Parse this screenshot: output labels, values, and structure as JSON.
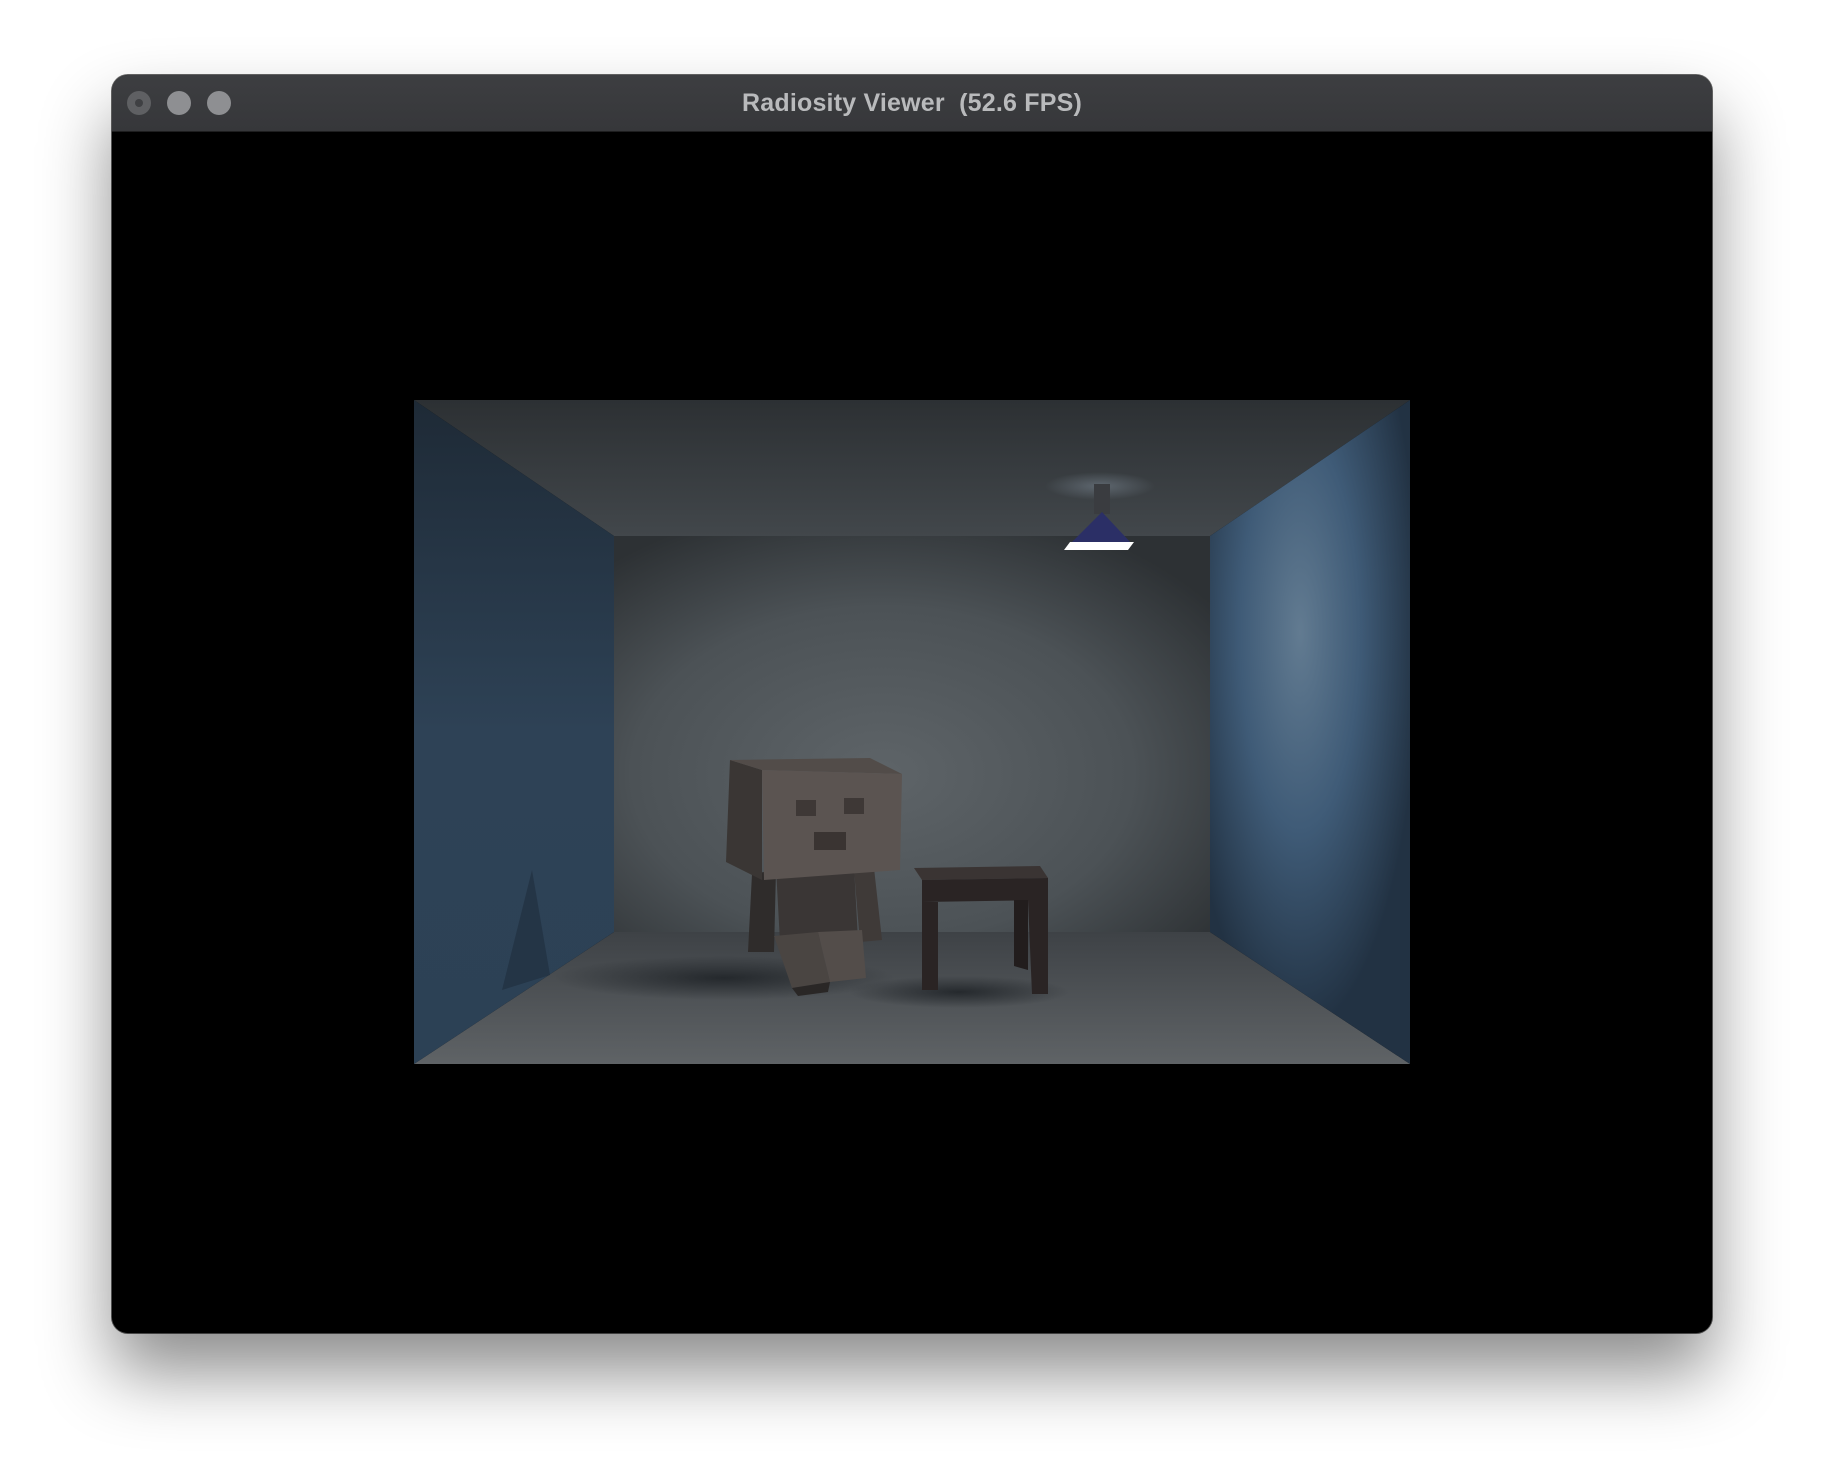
{
  "window": {
    "title": "Radiosity Viewer  (52.6 FPS)"
  },
  "colors": {
    "titlebar": "#3a3b3e",
    "title_text": "#b9babc",
    "traffic_light": "#8e8f92",
    "viewport_background": "#000000",
    "side_walls": "#3f5b78",
    "back_wall": "#5a6064",
    "lamp_shade": "#2b2f66"
  },
  "scene": {
    "objects": [
      "back-wall",
      "left-wall",
      "right-wall",
      "ceiling",
      "floor",
      "ceiling-lamp",
      "robot",
      "stool"
    ]
  }
}
